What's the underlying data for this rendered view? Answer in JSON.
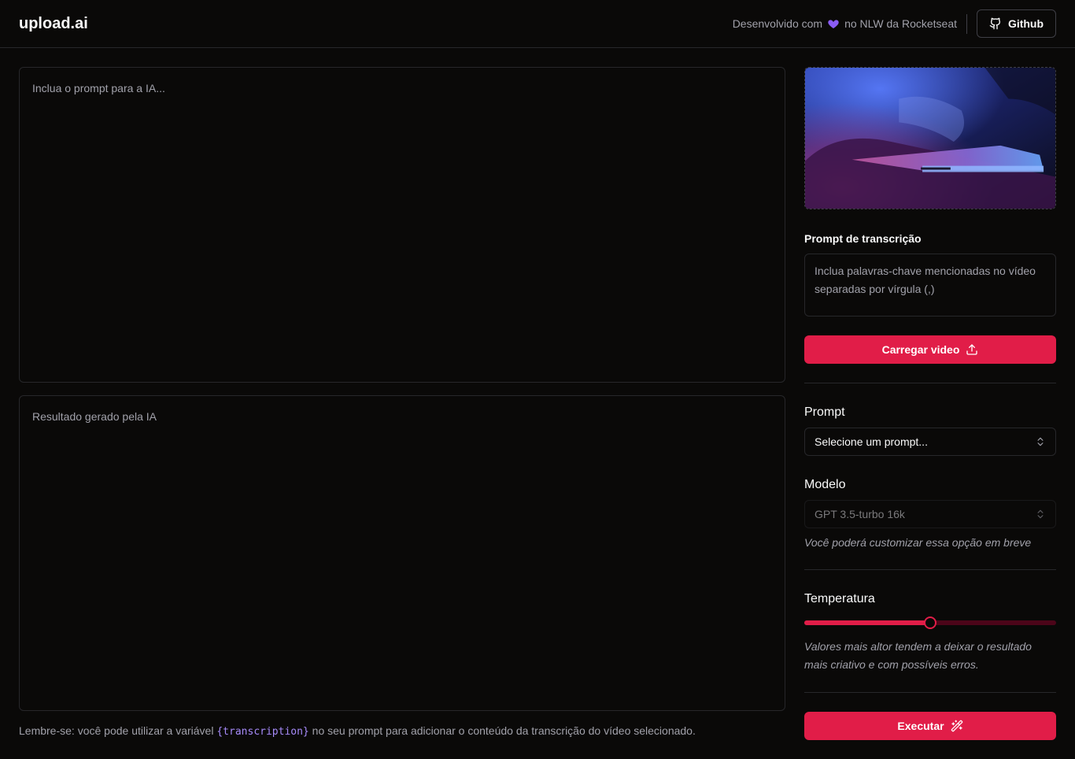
{
  "header": {
    "logo": "upload.ai",
    "credit_prefix": "Desenvolvido com",
    "credit_suffix": "no NLW da Rocketseat",
    "github_label": "Github"
  },
  "editor": {
    "prompt_placeholder": "Inclua o prompt para a IA...",
    "result_placeholder": "Resultado gerado pela IA",
    "hint_prefix": "Lembre-se: você pode utilizar a variável",
    "hint_variable": "{transcription}",
    "hint_suffix": "no seu prompt para adicionar o conteúdo da transcrição do vídeo selecionado."
  },
  "sidebar": {
    "transcription_label": "Prompt de transcrição",
    "transcription_placeholder": "Inclua palavras-chave mencionadas no vídeo separadas por vírgula (,)",
    "upload_button": "Carregar video",
    "prompt_label": "Prompt",
    "prompt_select_value": "Selecione um prompt...",
    "model_label": "Modelo",
    "model_select_value": "GPT 3.5-turbo 16k",
    "model_note": "Você poderá customizar essa opção em breve",
    "temperature_label": "Temperatura",
    "temperature_value": 0.5,
    "temperature_note": "Valores mais altor tendem a deixar o resultado mais criativo e com possíveis erros.",
    "execute_button": "Executar"
  },
  "colors": {
    "accent": "#e11d48",
    "heart": "#8b5cf6",
    "variable": "#a78bfa"
  }
}
